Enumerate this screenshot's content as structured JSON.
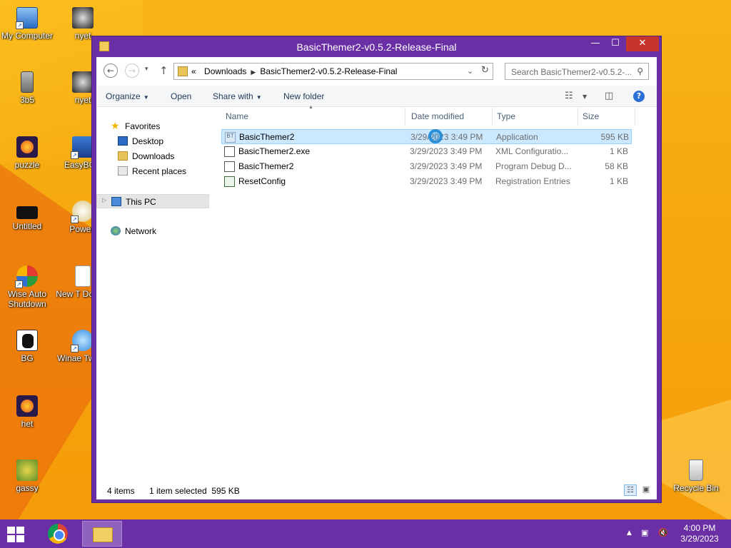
{
  "desktop": {
    "icons": [
      {
        "label": "My Computer"
      },
      {
        "label": "nyet"
      },
      {
        "label": "3b5"
      },
      {
        "label": "nyet"
      },
      {
        "label": "puzzle"
      },
      {
        "label": "EasyBCD"
      },
      {
        "label": "Untitled"
      },
      {
        "label": "PowerI"
      },
      {
        "label": "Wise Auto Shutdown"
      },
      {
        "label": "New T Docum"
      },
      {
        "label": "BG"
      },
      {
        "label": "Winae Tweak"
      },
      {
        "label": "het"
      },
      {
        "label": "gassy"
      },
      {
        "label": "Recycle Bin"
      }
    ]
  },
  "window": {
    "title": "BasicThemer2-v0.5.2-Release-Final",
    "controls": {
      "minimize": "—",
      "maximize": "☐",
      "close": "✕"
    }
  },
  "navbar": {
    "back": "←",
    "forward": "→",
    "history": "▾",
    "up": "↑",
    "address": {
      "overflow": "«",
      "crumbs": [
        "Downloads",
        "BasicThemer2-v0.5.2-Release-Final"
      ],
      "dropdown": "⌄",
      "refresh": "↻"
    },
    "search": {
      "placeholder": "Search BasicThemer2-v0.5.2-..."
    }
  },
  "commandbar": {
    "organize": "Organize",
    "open": "Open",
    "share_with": "Share with",
    "new_folder": "New folder",
    "help": "?"
  },
  "navpane": {
    "favorites": "Favorites",
    "desktop": "Desktop",
    "downloads": "Downloads",
    "recent": "Recent places",
    "this_pc": "This PC",
    "network": "Network"
  },
  "files": {
    "columns": [
      "Name",
      "Date modified",
      "Type",
      "Size"
    ],
    "rows": [
      {
        "name": "BasicThemer2",
        "date": "3/29/2023 3:49 PM",
        "type": "Application",
        "size": "595 KB",
        "icon": "app-icon",
        "selected": true
      },
      {
        "name": "BasicThemer2.exe",
        "date": "3/29/2023 3:49 PM",
        "type": "XML Configuratio...",
        "size": "1 KB",
        "icon": "config-icon",
        "selected": false
      },
      {
        "name": "BasicThemer2",
        "date": "3/29/2023 3:49 PM",
        "type": "Program Debug D...",
        "size": "58 KB",
        "icon": "debug-icon",
        "selected": false
      },
      {
        "name": "ResetConfig",
        "date": "3/29/2023 3:49 PM",
        "type": "Registration Entries",
        "size": "1 KB",
        "icon": "registry-icon",
        "selected": false
      }
    ]
  },
  "status": {
    "items": "4 items",
    "selection": "1 item selected  595 KB"
  },
  "taskbar": {
    "apps": [
      "start-button",
      "chrome-icon",
      "file-explorer-icon"
    ],
    "time": "4:00 PM",
    "date": "3/29/2023"
  },
  "colors": {
    "window_frame": "#6a2fa4",
    "selection": "#cce8ff",
    "desktop": "#f6a80e"
  }
}
